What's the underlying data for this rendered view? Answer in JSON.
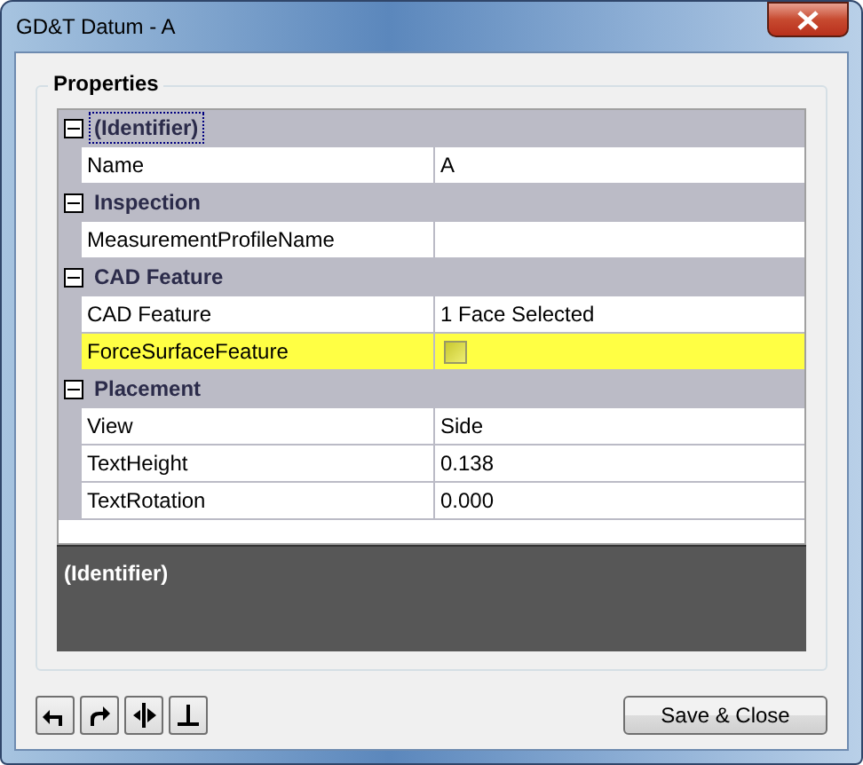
{
  "window": {
    "title": "GD&T Datum - A"
  },
  "group": {
    "title": "Properties"
  },
  "categories": [
    {
      "name": "(Identifier)",
      "expanded": true,
      "selected": true,
      "properties": [
        {
          "name": "Name",
          "value": "A",
          "kind": "text",
          "highlighted": false
        }
      ]
    },
    {
      "name": "Inspection",
      "expanded": true,
      "selected": false,
      "properties": [
        {
          "name": "MeasurementProfileName",
          "kind": "text",
          "highlighted": false
        }
      ]
    },
    {
      "name": "CAD Feature",
      "expanded": true,
      "selected": false,
      "properties": [
        {
          "name": "CAD Feature",
          "value": "1 Face Selected",
          "kind": "text",
          "highlighted": false
        },
        {
          "name": "ForceSurfaceFeature",
          "kind": "checkbox",
          "checked": false,
          "highlighted": true
        }
      ]
    },
    {
      "name": "Placement",
      "expanded": true,
      "selected": false,
      "properties": [
        {
          "name": "View",
          "value": "Side",
          "kind": "text",
          "highlighted": false
        },
        {
          "name": "TextHeight",
          "value": "0.138",
          "kind": "text",
          "highlighted": false
        },
        {
          "name": "TextRotation",
          "value": "0.000",
          "kind": "text",
          "highlighted": false
        }
      ]
    }
  ],
  "description": {
    "title": "(Identifier)"
  },
  "toolbar": [
    {
      "kind": "undo"
    },
    {
      "kind": "redo"
    },
    {
      "kind": "flip"
    },
    {
      "kind": "perpendicular"
    }
  ],
  "buttons": [
    "Save & Close"
  ]
}
